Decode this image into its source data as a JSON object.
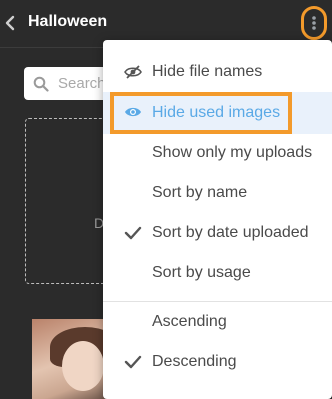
{
  "header": {
    "title": "Halloween"
  },
  "search": {
    "placeholder": "Search"
  },
  "upload": {
    "text": "D"
  },
  "menu": {
    "hide_file_names": "Hide file names",
    "hide_used_images": "Hide used images",
    "show_only_my_uploads": "Show only my uploads",
    "sort_by_name": "Sort by name",
    "sort_by_date_uploaded": "Sort by date uploaded",
    "sort_by_usage": "Sort by usage",
    "ascending": "Ascending",
    "descending": "Descending"
  },
  "colors": {
    "highlight": "#f39a2b",
    "active_item": "#5aa9e6",
    "background": "#2b2b2b"
  },
  "icons": {
    "back": "chevron-left-icon",
    "more": "kebab-menu-icon",
    "search": "search-icon",
    "hide_names": "eye-slash-icon",
    "hide_used": "eye-icon",
    "check": "check-icon"
  }
}
